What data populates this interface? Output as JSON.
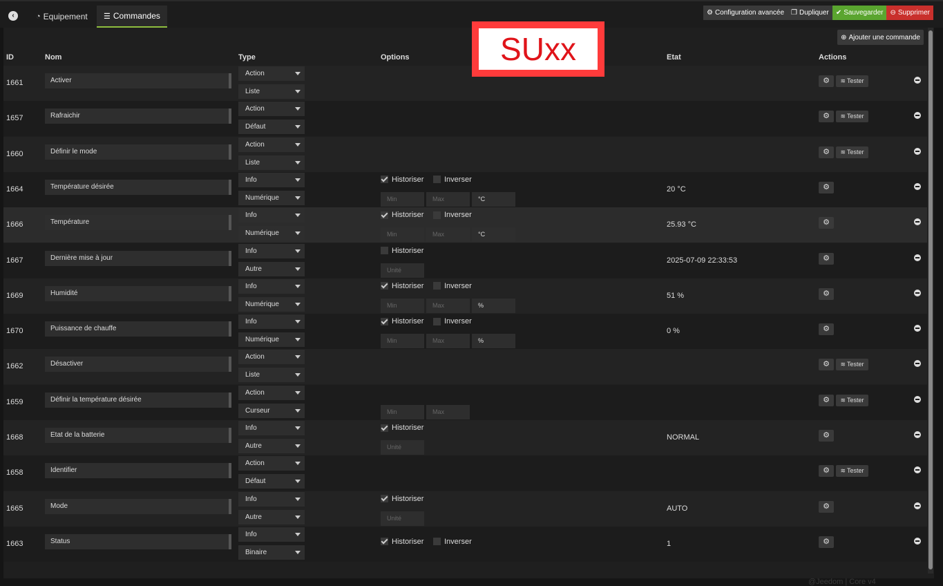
{
  "tabs": [
    {
      "label": "Equipement",
      "icon": "tachometer-icon"
    },
    {
      "label": "Commandes",
      "icon": "list-icon"
    }
  ],
  "top_buttons": [
    {
      "label": "Configuration avancée",
      "icon": "cogs-icon",
      "color": "#3a3a3a"
    },
    {
      "label": "Dupliquer",
      "icon": "copy-icon",
      "color": "#3a3a3a"
    },
    {
      "label": "Sauvegarder",
      "icon": "check-circle-icon",
      "color": "#5aa52f"
    },
    {
      "label": "Supprimer",
      "icon": "minus-circle-icon",
      "color": "#c9302c"
    }
  ],
  "add_button": "Ajouter une commande",
  "headers": {
    "id": "ID",
    "nom": "Nom",
    "type": "Type",
    "options": "Options",
    "etat": "Etat",
    "actions": "Actions"
  },
  "overlay_text": "SUxx",
  "tester_label": "Tester",
  "historiser_label": "Historiser",
  "inverser_label": "Inverser",
  "placeholders": {
    "min": "Min",
    "max": "Max",
    "unite": "Unité"
  },
  "footer": "@Jeedom | Core v4",
  "rows": [
    {
      "id": "1661",
      "name": "Activer",
      "type": "Action",
      "subtype": "Liste",
      "options": "none",
      "etat": "",
      "tester": true
    },
    {
      "id": "1657",
      "name": "Rafraichir",
      "type": "Action",
      "subtype": "Défaut",
      "options": "none",
      "etat": "",
      "tester": true
    },
    {
      "id": "1660",
      "name": "Définir le mode",
      "type": "Action",
      "subtype": "Liste",
      "options": "none",
      "etat": "",
      "tester": true
    },
    {
      "id": "1664",
      "name": "Température désirée",
      "type": "Info",
      "subtype": "Numérique",
      "options": "num",
      "historiser": true,
      "inverser": false,
      "unit": "°C",
      "etat": "20 °C",
      "tester": false
    },
    {
      "id": "1666",
      "name": "Température",
      "type": "Info",
      "subtype": "Numérique",
      "options": "num",
      "historiser": true,
      "inverser": false,
      "unit": "°C",
      "etat": "25.93 °C",
      "tester": false,
      "highlight": true
    },
    {
      "id": "1667",
      "name": "Dernière mise à jour",
      "type": "Info",
      "subtype": "Autre",
      "options": "other",
      "historiser": false,
      "etat": "2025-07-09 22:33:53",
      "tester": false
    },
    {
      "id": "1669",
      "name": "Humidité",
      "type": "Info",
      "subtype": "Numérique",
      "options": "num",
      "historiser": true,
      "inverser": false,
      "unit": "%",
      "etat": "51 %",
      "tester": false
    },
    {
      "id": "1670",
      "name": "Puissance de chauffe",
      "type": "Info",
      "subtype": "Numérique",
      "options": "num",
      "historiser": true,
      "inverser": false,
      "unit": "%",
      "etat": "0 %",
      "tester": false
    },
    {
      "id": "1662",
      "name": "Désactiver",
      "type": "Action",
      "subtype": "Liste",
      "options": "none",
      "etat": "",
      "tester": true
    },
    {
      "id": "1659",
      "name": "Définir la température désirée",
      "type": "Action",
      "subtype": "Curseur",
      "options": "slider",
      "etat": "",
      "tester": true
    },
    {
      "id": "1668",
      "name": "Etat de la batterie",
      "type": "Info",
      "subtype": "Autre",
      "options": "other",
      "historiser": true,
      "etat": "NORMAL",
      "tester": false
    },
    {
      "id": "1658",
      "name": "Identifier",
      "type": "Action",
      "subtype": "Défaut",
      "options": "none",
      "etat": "",
      "tester": true
    },
    {
      "id": "1665",
      "name": "Mode",
      "type": "Info",
      "subtype": "Autre",
      "options": "other",
      "historiser": true,
      "etat": "AUTO",
      "tester": false
    },
    {
      "id": "1663",
      "name": "Status",
      "type": "Info",
      "subtype": "Binaire",
      "options": "binary",
      "historiser": true,
      "inverser": false,
      "etat": "1",
      "tester": false
    }
  ]
}
